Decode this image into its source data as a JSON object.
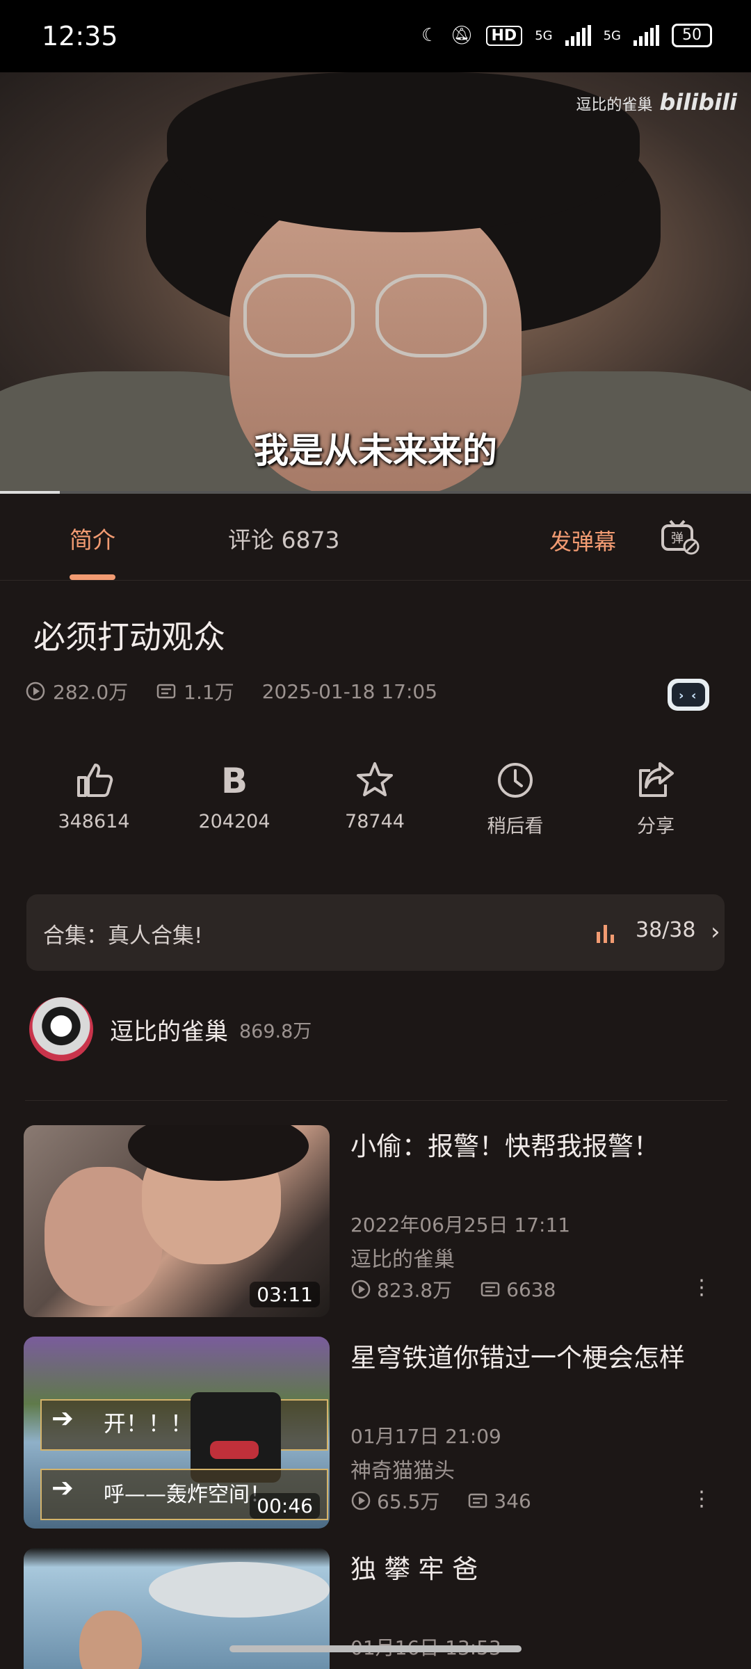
{
  "status_bar": {
    "time": "12:35",
    "hd": "HD",
    "net1": "5G",
    "net2": "5G",
    "battery": "50"
  },
  "video": {
    "watermark_user": "逗比的雀巢",
    "watermark_brand": "bilibili",
    "subtitle": "我是从未来来的",
    "progress": 0.08
  },
  "tabs": {
    "intro": "简介",
    "comments": "评论 6873",
    "send_danmaku": "发弹幕"
  },
  "info": {
    "title": "必须打动观众",
    "views": "282.0万",
    "danmaku_count": "1.1万",
    "date": "2025-01-18 17:05"
  },
  "actions": [
    {
      "label": "348614",
      "icon": "thumbs-up-icon"
    },
    {
      "label": "204204",
      "icon": "coin-icon"
    },
    {
      "label": "78744",
      "icon": "star-icon"
    },
    {
      "label": "稍后看",
      "icon": "clock-icon"
    },
    {
      "label": "分享",
      "icon": "share-icon"
    }
  ],
  "collection": {
    "label": "合集：真人合集!",
    "count": "38/38",
    "accent": "#f29b72"
  },
  "uploader": {
    "name": "逗比的雀巢",
    "fans": "869.8万"
  },
  "recommendations": [
    {
      "title": "小偷：报警！快帮我报警！",
      "date": "2022年06月25日  17:11",
      "uploader": "逗比的雀巢",
      "views": "823.8万",
      "danmaku": "6638",
      "duration": "03:11"
    },
    {
      "title": "星穹铁道你错过一个梗会怎样",
      "date": "01月17日  21:09",
      "uploader": "神奇猫猫头",
      "views": "65.5万",
      "danmaku": "346",
      "duration": "00:46",
      "overlay1": "开！！！",
      "overlay2": "呼——轰炸空间！"
    },
    {
      "title": "独 攀 牢 爸",
      "date": "01月16日  13:53"
    }
  ]
}
